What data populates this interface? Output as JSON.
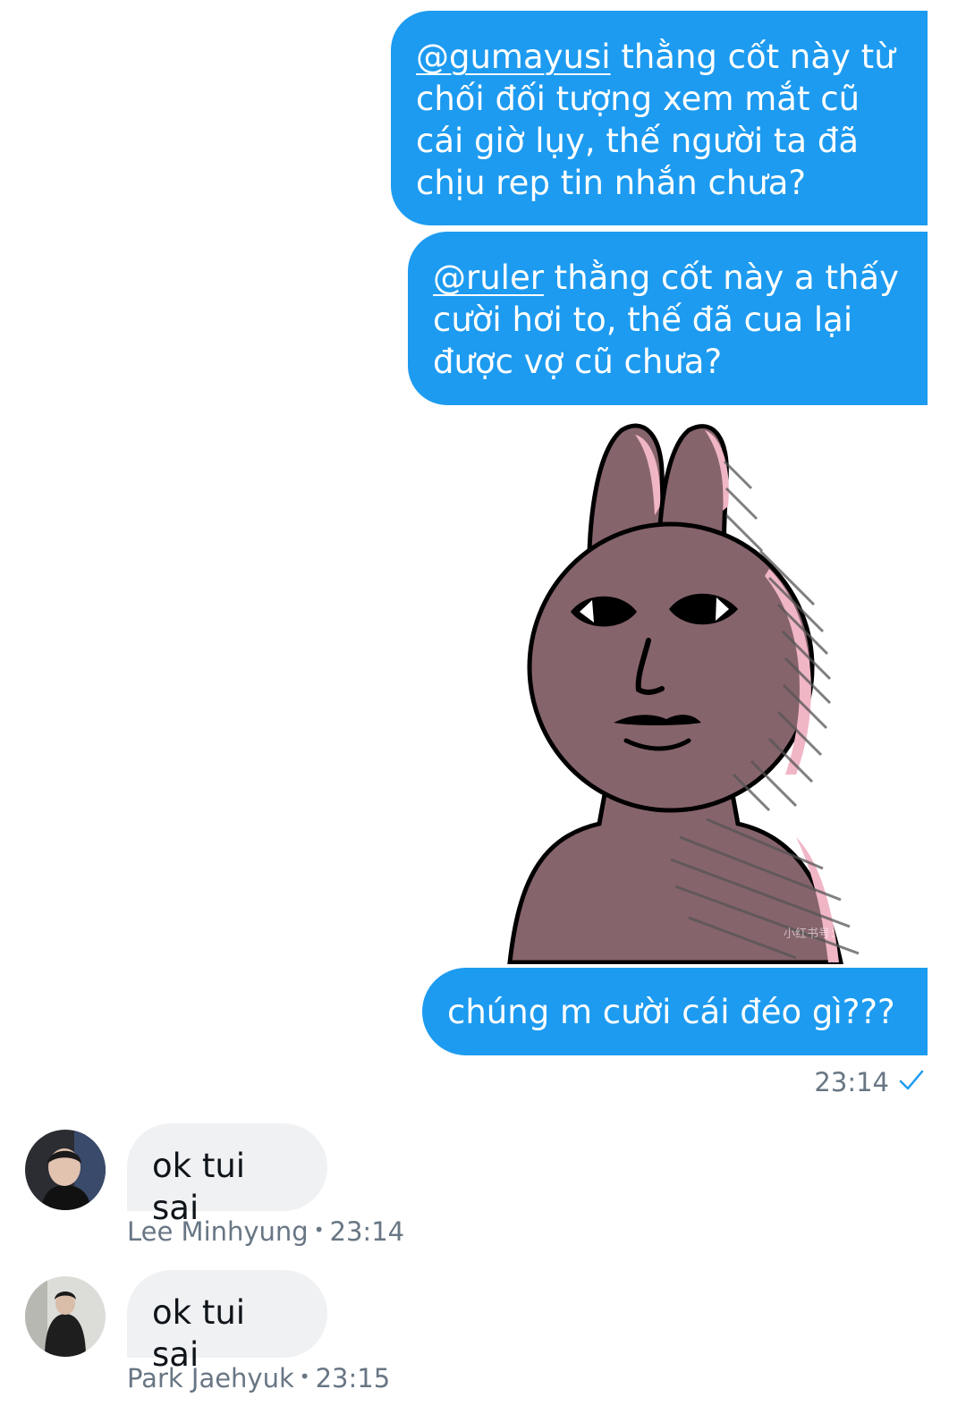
{
  "outgoing": {
    "message1": {
      "mention": "@gumayusi",
      "text": " thằng cốt này từ chối đối tượng xem mắt cũ cái giờ lụy, thế người ta đã chịu rep tin nhắn chưa?"
    },
    "message2": {
      "mention": "@ruler",
      "text": " thằng cốt này a thấy cười hơi to, thế đã cua lại được vợ cũ chưa?"
    },
    "sticker": {
      "watermark": "小红书号："
    },
    "message3": {
      "text": "chúng m cười cái đéo gì???"
    },
    "time": "23:14",
    "accent_color": "#1d9bf0"
  },
  "incoming": [
    {
      "text": "ok tui sai",
      "sender": "Lee Minhyung",
      "separator": "•",
      "time": "23:14"
    },
    {
      "text": "ok tui sai",
      "sender": "Park Jaehyuk",
      "separator": "•",
      "time": "23:15"
    }
  ]
}
